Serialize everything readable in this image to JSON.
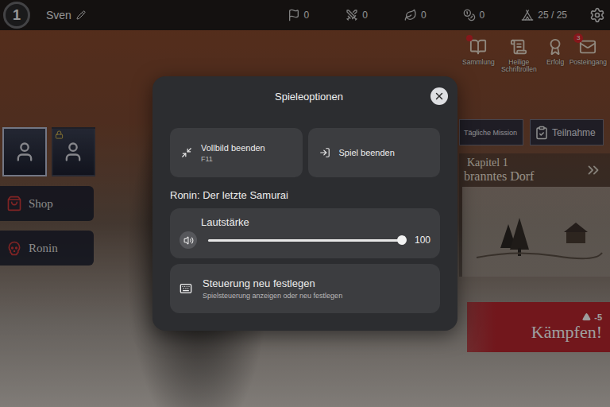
{
  "player": {
    "level": "1",
    "name": "Sven"
  },
  "resources": [
    {
      "value": "0"
    },
    {
      "value": "0"
    },
    {
      "value": "0"
    },
    {
      "value": "0"
    },
    {
      "value": "25 / 25"
    }
  ],
  "menu_icons": [
    {
      "label": "Sammlung",
      "dot": true,
      "badge": ""
    },
    {
      "label": "Heilige Schriftrollen",
      "dot": false,
      "badge": ""
    },
    {
      "label": "Erfolg",
      "dot": false,
      "badge": ""
    },
    {
      "label": "Posteingang",
      "dot": false,
      "badge": "3"
    }
  ],
  "characters": [
    {
      "locked": false,
      "selected": true
    },
    {
      "locked": true,
      "selected": false
    }
  ],
  "side_buttons": [
    {
      "label": "Shop"
    },
    {
      "label": "Ronin"
    }
  ],
  "mission_buttons": [
    {
      "label": "Tägliche Mission"
    },
    {
      "label": "Teilnahme"
    }
  ],
  "chapter": {
    "title": "Kapitel 1",
    "name": "branntes Dorf"
  },
  "fight": {
    "cost": "-5",
    "label": "Kämpfen!"
  },
  "dialog": {
    "title": "Spieleoptionen",
    "actions": [
      {
        "label": "Vollbild beenden",
        "shortcut": "F11"
      },
      {
        "label": "Spiel beenden",
        "shortcut": ""
      }
    ],
    "section": "Ronin: Der letzte Samurai",
    "volume": {
      "label": "Lautstärke",
      "level": 1,
      "reading": "100"
    },
    "controls": {
      "title": "Steuerung neu festlegen",
      "subtitle": "Spielsteuerung anzeigen oder neu festlegen"
    }
  }
}
